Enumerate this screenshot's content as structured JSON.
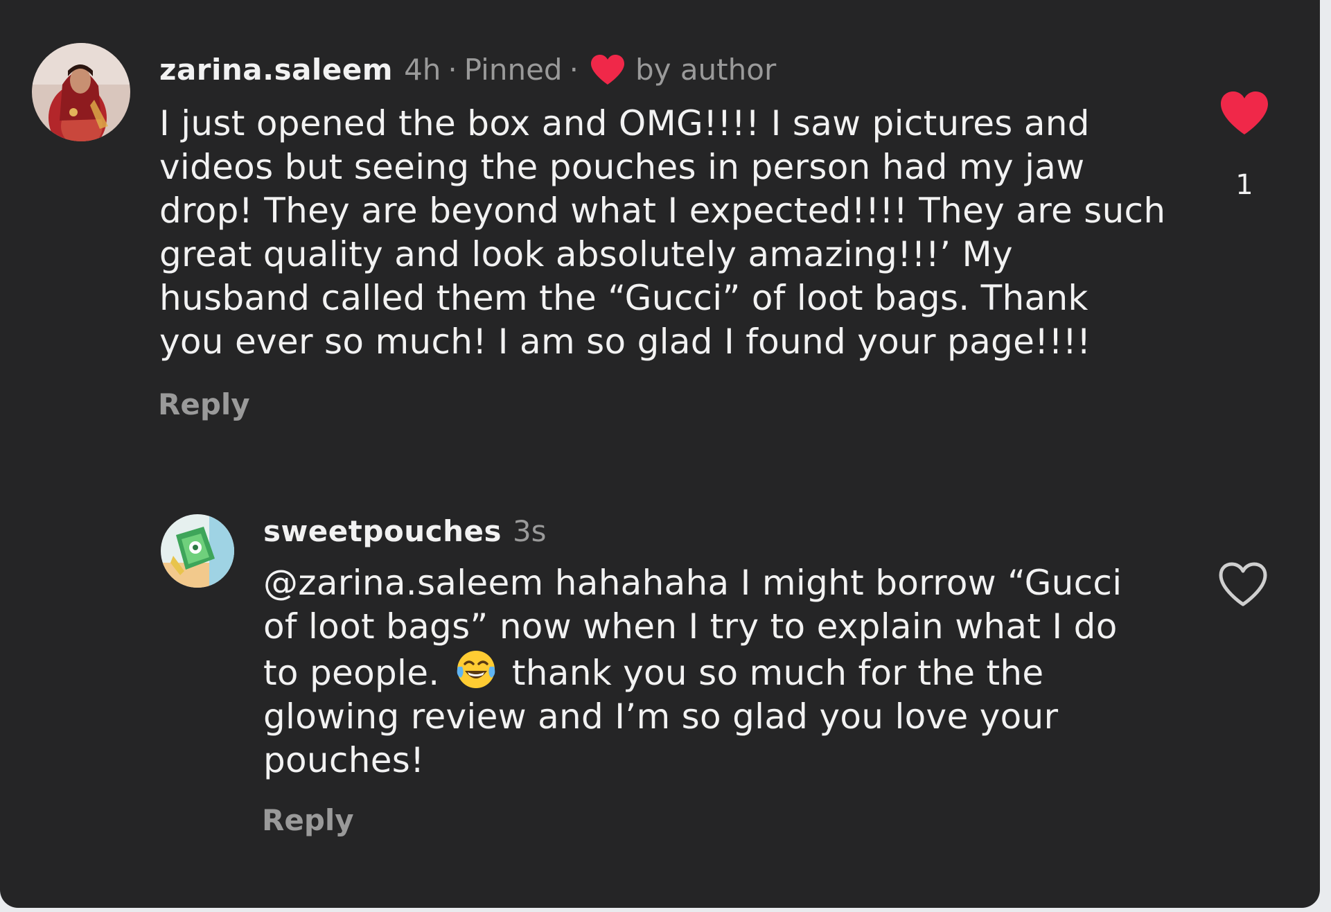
{
  "comments": [
    {
      "username": "zarina.saleem",
      "time": "4h",
      "pinned": "Pinned",
      "liked_by_author": "by author",
      "text_lines": [
        "I just opened the box and OMG!!!! I saw pictures and",
        "videos but seeing the pouches in person had my jaw",
        "drop! They are beyond what I expected!!!! They are such",
        "great quality and look absolutely amazing!!!’ My",
        "husband called them the “Gucci” of loot bags. Thank",
        "you ever so much! I am so glad I found your page!!!!"
      ],
      "reply_label": "Reply",
      "like_count": "1",
      "liked": true
    },
    {
      "username": "sweetpouches",
      "time": "3s",
      "text_lines": [
        "@zarina.saleem hahahaha I might borrow “Gucci",
        "of loot bags” now when I try to explain what I do",
        "to people.",
        "thank you so much for the the",
        "glowing review and I’m so glad you love your",
        "pouches!"
      ],
      "reply_label": "Reply",
      "liked": false
    }
  ],
  "colors": {
    "background": "#252526",
    "text": "#f2f2f2",
    "muted": "#9a9a9a",
    "heart": "#f02849"
  },
  "icons": {
    "like_filled": "heart-filled-icon",
    "like_outline": "heart-outline-icon",
    "author_heart": "heart-small-icon",
    "emoji": "face-with-tears-of-joy-icon"
  }
}
